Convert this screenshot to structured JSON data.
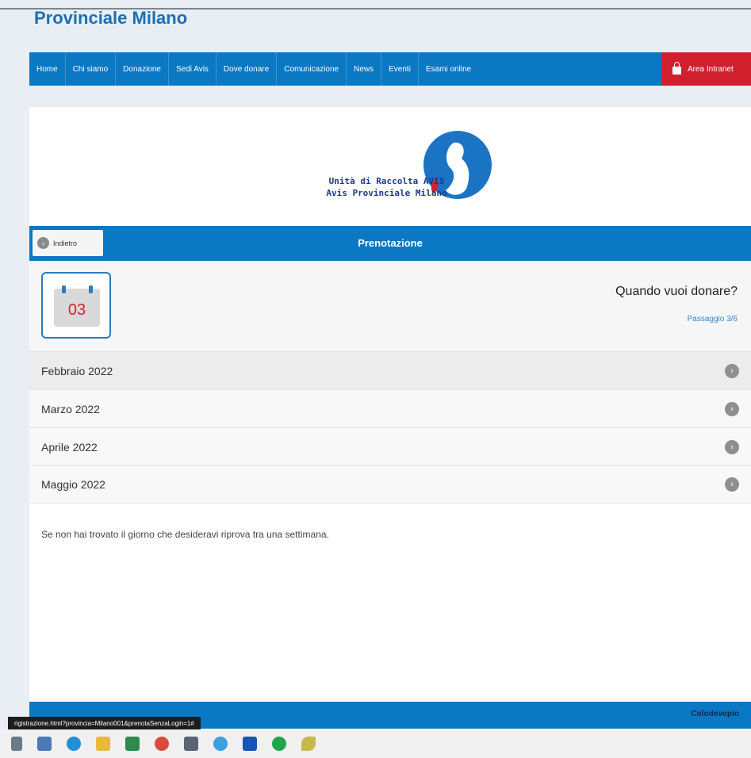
{
  "site": {
    "title": "Provinciale Milano"
  },
  "nav": {
    "items": [
      "Home",
      "Chi siamo",
      "Donazione",
      "Sedi Avis",
      "Dove donare",
      "Comunicazione",
      "News",
      "Eventi",
      "Esami online"
    ],
    "intranet_label": "Area Intranet"
  },
  "logo": {
    "line1": "Unità di Raccolta AVIS",
    "line2": "Avis Provinciale Milano"
  },
  "booking": {
    "back_label": "Indietro",
    "title": "Prenotazione",
    "calendar_day": "03",
    "question": "Quando vuoi donare?",
    "step": "Passaggio 3/6",
    "months": [
      "Febbraio 2022",
      "Marzo 2022",
      "Aprile 2022",
      "Maggio 2022"
    ],
    "note": "Se non hai trovato il giorno che desideravi riprova tra una settimana."
  },
  "footer": {
    "right_text": "Colodevopio"
  },
  "status_url": "rigistrazione.html?provincia=Milano001&prenotaSenzaLogin=1#",
  "taskbar": {
    "icons": [
      "task-view-icon",
      "file-explorer-icon",
      "edge-icon",
      "folder-icon",
      "excel-icon",
      "chrome-icon",
      "calculator-icon",
      "ie-icon",
      "store-icon",
      "app-icon",
      "paint-icon"
    ]
  },
  "colors": {
    "accent": "#0a78c2",
    "intranet": "#d0202e",
    "calendar_number": "#d3222b"
  }
}
